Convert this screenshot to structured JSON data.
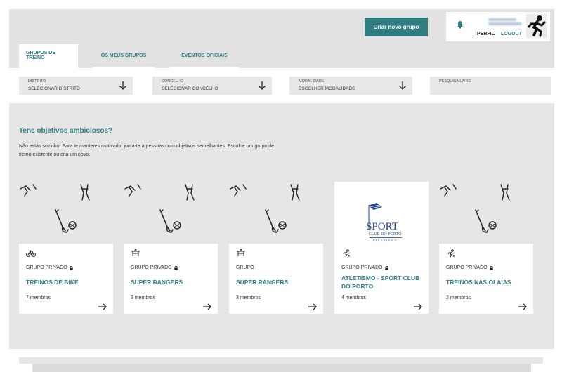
{
  "header": {
    "create_button": "Criar novo grupo",
    "perfil": "PERFIL",
    "logout": "LOGOUT"
  },
  "tabs": [
    {
      "label": "GRUPOS DE TREINO",
      "active": true
    },
    {
      "label": "OS MEUS GRUPOS",
      "active": false
    },
    {
      "label": "EVENTOS OFICIAIS",
      "active": false
    }
  ],
  "filters": [
    {
      "label": "DISTRITO",
      "value": "SELECIONAR DISTRITO"
    },
    {
      "label": "CONCELHO",
      "value": "SELECIONAR CONCELHO"
    },
    {
      "label": "MODALIDADE",
      "value": "ESCOLHER MODALIDADE"
    },
    {
      "label": "PESQUISA LIVRE",
      "value": ""
    }
  ],
  "main": {
    "title": "Tens objetivos ambiciosos?",
    "description": "Não estás sozinho. Para te manteres motivado, junta-te a pessoas com objetivos semelhantes. Escolhe um grupo de treino existente ou cria um novo."
  },
  "cards": [
    {
      "type": "GRUPO PRIVADO",
      "private": true,
      "name": "TREINOS DE BIKE",
      "members": "7 membros",
      "icon": "bike-icon",
      "image": "sports-pattern"
    },
    {
      "type": "GRUPO PRIVADO",
      "private": true,
      "name": "SUPER RANGERS",
      "members": "3 membros",
      "icon": "trampoline-icon",
      "image": "sports-pattern"
    },
    {
      "type": "GRUPO",
      "private": false,
      "name": "SUPER RANGERS",
      "members": "3 membros",
      "icon": "trampoline-icon",
      "image": "sports-pattern"
    },
    {
      "type": "GRUPO PRIVADO",
      "private": true,
      "name": "ATLETISMO - SPORT CLUB DO PORTO",
      "members": "4 membros",
      "icon": "runner-icon",
      "image": "sport-club-logo",
      "logo_text": "SPORT",
      "logo_sub": "CLUB DO PORTO",
      "logo_small": "ATLETISMO"
    },
    {
      "type": "GRUPO PRIVADO",
      "private": true,
      "name": "TREINOS NAS OLAIAS",
      "members": "2 membros",
      "icon": "runner-icon",
      "image": "sports-pattern"
    }
  ],
  "colors": {
    "accent": "#2f7d80"
  }
}
